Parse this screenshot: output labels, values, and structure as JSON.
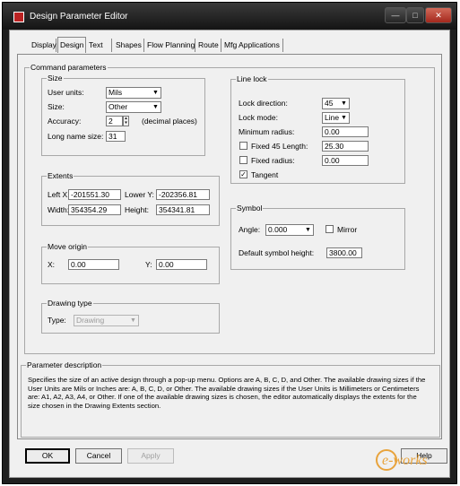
{
  "window": {
    "title": "Design Parameter Editor",
    "controls": {
      "minimize": "—",
      "maximize": "□",
      "close": "✕"
    }
  },
  "tabs": [
    {
      "label": "Display",
      "active": false
    },
    {
      "label": "Design",
      "active": true
    },
    {
      "label": "Text",
      "active": false
    },
    {
      "label": "Shapes",
      "active": false
    },
    {
      "label": "Flow Planning",
      "active": false
    },
    {
      "label": "Route",
      "active": false
    },
    {
      "label": "Mfg Applications",
      "active": false
    }
  ],
  "command_parameters": {
    "title": "Command parameters",
    "size": {
      "title": "Size",
      "user_units_label": "User units:",
      "user_units_value": "Mils",
      "size_label": "Size:",
      "size_value": "Other",
      "accuracy_label": "Accuracy:",
      "accuracy_value": "2",
      "accuracy_note": "(decimal places)",
      "long_name_label": "Long name size:",
      "long_name_value": "31"
    },
    "extents": {
      "title": "Extents",
      "left_x_label": "Left X:",
      "left_x_value": "-201551.30",
      "lower_y_label": "Lower Y:",
      "lower_y_value": "-202356.81",
      "width_label": "Width:",
      "width_value": "354354.29",
      "height_label": "Height:",
      "height_value": "354341.81"
    },
    "move_origin": {
      "title": "Move origin",
      "x_label": "X:",
      "x_value": "0.00",
      "y_label": "Y:",
      "y_value": "0.00"
    },
    "drawing_type": {
      "title": "Drawing type",
      "type_label": "Type:",
      "type_value": "Drawing"
    },
    "line_lock": {
      "title": "Line lock",
      "lock_direction_label": "Lock direction:",
      "lock_direction_value": "45",
      "lock_mode_label": "Lock mode:",
      "lock_mode_value": "Line",
      "min_radius_label": "Minimum radius:",
      "min_radius_value": "0.00",
      "fixed45_label": "Fixed 45 Length:",
      "fixed45_checked": false,
      "fixed45_value": "25.30",
      "fixed_radius_label": "Fixed radius:",
      "fixed_radius_checked": false,
      "fixed_radius_value": "0.00",
      "tangent_label": "Tangent",
      "tangent_checked": true
    },
    "symbol": {
      "title": "Symbol",
      "angle_label": "Angle:",
      "angle_value": "0.000",
      "mirror_label": "Mirror",
      "mirror_checked": false,
      "default_height_label": "Default symbol height:",
      "default_height_value": "3800.00"
    }
  },
  "parameter_description": {
    "title": "Parameter description",
    "text": "Specifies the size of an active design through a pop-up menu. Options are A, B, C, D, and Other.  The available drawing sizes if the User Units are Mils or Inches are: A, B, C, D, or Other.  The available drawing sizes if the User Units is Millimeters or Centimeters are: A1, A2, A3, A4, or Other. If one of the available drawing sizes is chosen, the editor automatically displays the extents for the size chosen in the Drawing Extents section."
  },
  "buttons": {
    "ok": "OK",
    "cancel": "Cancel",
    "apply": "Apply",
    "help": "Help"
  },
  "watermark": {
    "text": "e-works",
    "color": "#e8a33c"
  },
  "colors": {
    "titlebar": "#1a1a1a",
    "dialog_bg": "#f0f0f0",
    "close_button": "#c0392b"
  }
}
